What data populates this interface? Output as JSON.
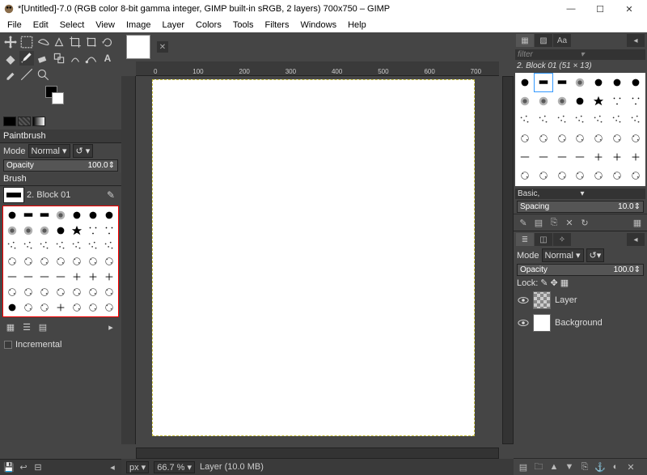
{
  "titlebar": {
    "title": "*[Untitled]-7.0 (RGB color 8-bit gamma integer, GIMP built-in sRGB, 2 layers) 700x750 – GIMP"
  },
  "menu": [
    "File",
    "Edit",
    "Select",
    "View",
    "Image",
    "Layer",
    "Colors",
    "Tools",
    "Filters",
    "Windows",
    "Help"
  ],
  "tool_options": {
    "title": "Paintbrush",
    "mode_label": "Mode",
    "mode_value": "Normal",
    "opacity_label": "Opacity",
    "opacity_value": "100.0",
    "brush_label": "Brush",
    "brush_name": "2. Block 01",
    "incremental_label": "Incremental"
  },
  "right": {
    "filter_placeholder": "filter",
    "brush_info": "2. Block 01 (51 × 13)",
    "brush_cat": "Basic,",
    "spacing_label": "Spacing",
    "spacing_value": "10.0",
    "layer_mode_label": "Mode",
    "layer_mode_value": "Normal",
    "layer_opacity_label": "Opacity",
    "layer_opacity_value": "100.0",
    "lock_label": "Lock:",
    "layers": [
      {
        "name": "Layer",
        "bg": "checker"
      },
      {
        "name": "Background",
        "bg": "white"
      }
    ]
  },
  "status": {
    "unit": "px",
    "zoom": "66.7 %",
    "info": "Layer (10.0 MB)"
  },
  "ruler_marks": [
    "0",
    "100",
    "200",
    "300",
    "400",
    "500",
    "600",
    "700"
  ]
}
